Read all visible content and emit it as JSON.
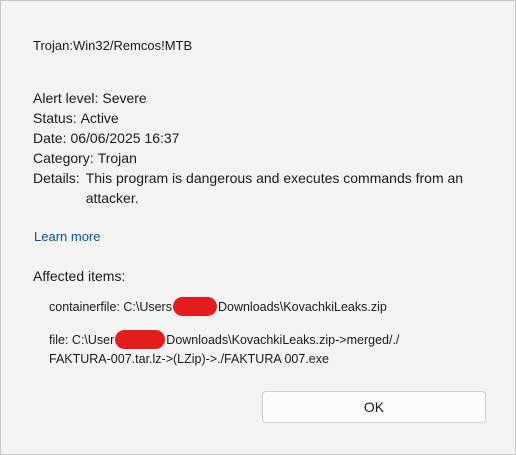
{
  "threat": {
    "name": "Trojan:Win32/Remcos!MTB"
  },
  "properties": {
    "alert_level_label": "Alert level:",
    "alert_level_value": "Severe",
    "status_label": "Status:",
    "status_value": "Active",
    "date_label": "Date:",
    "date_value": "06/06/2025 16:37",
    "category_label": "Category:",
    "category_value": "Trojan",
    "details_label": "Details:",
    "details_value": "This program is dangerous and executes commands from an attacker."
  },
  "learn_more": {
    "label": "Learn more"
  },
  "affected": {
    "heading": "Affected items:",
    "items": [
      {
        "prefix": "containerfile: C:\\Users",
        "suffix": "Downloads\\KovachkiLeaks.zip"
      },
      {
        "prefix": "file: C:\\User",
        "suffix": "Downloads\\KovachkiLeaks.zip->merged/./",
        "line2": "FAKTURA-007.tar.lz->(LZip)->./FAKTURA 007.exe"
      }
    ]
  },
  "buttons": {
    "ok_label": "OK"
  },
  "colors": {
    "link": "#0b5394",
    "redaction": "#e31d1d",
    "background": "#f3f3f3"
  }
}
